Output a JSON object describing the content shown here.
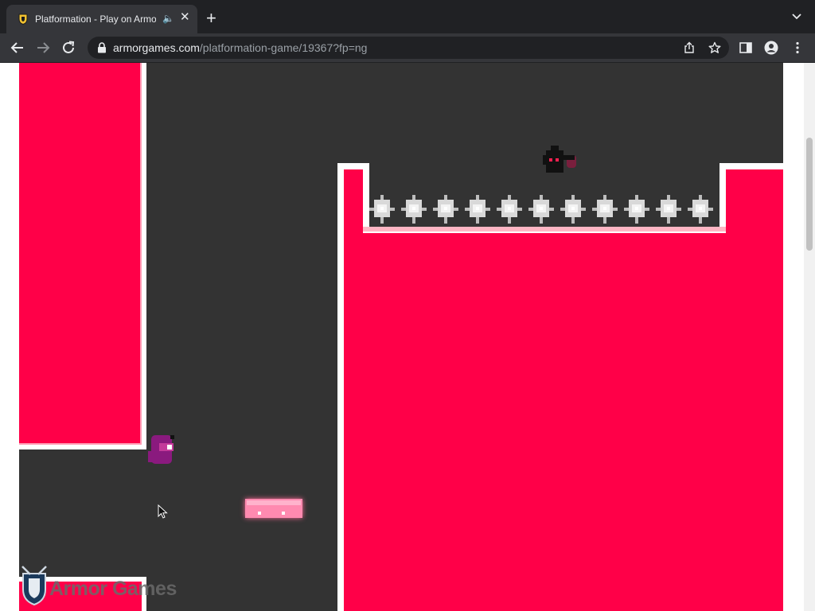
{
  "browser": {
    "tab": {
      "title": "Platformation - Play on Armor Games"
    },
    "address": {
      "host": "armorgames.com",
      "path": "/platformation-game/19367?fp=ng"
    }
  },
  "icons": [
    "armor-games-favicon",
    "speaker-icon",
    "close-icon",
    "plus-icon",
    "chevron-down-icon",
    "back-arrow-icon",
    "forward-arrow-icon",
    "reload-icon",
    "lock-icon",
    "share-icon",
    "star-icon",
    "side-panel-icon",
    "profile-icon",
    "menu-dots-icon",
    "mouse-cursor-icon",
    "shield-logo-icon"
  ],
  "game": {
    "watermark": "Armor Games",
    "colors": {
      "background": "#333333",
      "wall": "#ff0048",
      "wall_border": "#ffb6c4",
      "spike": "#e0e0e0",
      "player": "#8a1a7e",
      "platform": "#ff8ab0",
      "enemy": "#111111"
    },
    "spike_count": 11
  }
}
